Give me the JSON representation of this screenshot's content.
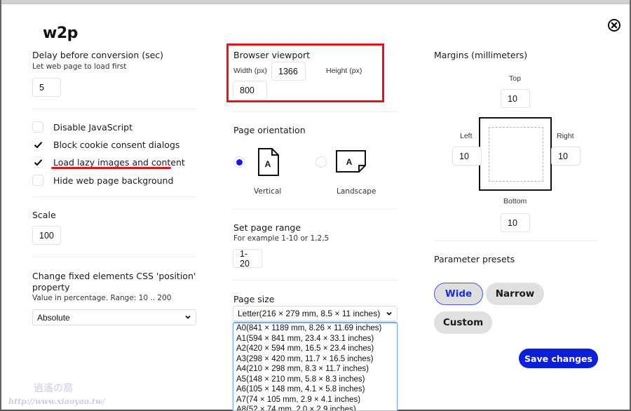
{
  "app": {
    "logo_text": "w2p",
    "close_icon": "close-circle-icon"
  },
  "delay": {
    "title": "Delay before conversion (sec)",
    "hint": "Let web page to load first",
    "value": "5"
  },
  "options": [
    {
      "label": "Disable JavaScript",
      "checked": false
    },
    {
      "label": "Block cookie consent dialogs",
      "checked": true
    },
    {
      "label": "Load lazy images and content",
      "checked": true
    },
    {
      "label": "Hide web page background",
      "checked": false
    }
  ],
  "scale": {
    "title": "Scale",
    "value": "100"
  },
  "css_position": {
    "title_line1": "Change fixed elements CSS 'position'",
    "title_line2": "property",
    "hint": "Value in percentage. Range: 10 .. 200",
    "selected": "Absolute"
  },
  "viewport": {
    "title": "Browser viewport",
    "width_label": "Width (px)",
    "width_value": "1366",
    "height_label": "Height (px)",
    "height_value": "800"
  },
  "orientation": {
    "title": "Page orientation",
    "options": [
      {
        "label": "Vertical",
        "selected": true,
        "icon_letter": "A"
      },
      {
        "label": "Landscape",
        "selected": false,
        "icon_letter": "A"
      }
    ]
  },
  "page_range": {
    "title": "Set page range",
    "hint": "For example 1-10 or 1,2,5",
    "value": "1-20"
  },
  "page_size": {
    "title": "Page size",
    "selected": "Letter(216 × 279 mm, 8.5 × 11 inches)",
    "options": [
      "A0(841 × 1189 mm, 8.26 × 11.69 inches)",
      "A1(594 × 841 mm, 23.4 × 33.1 inches)",
      "A2(420 × 594 mm, 16.5 × 23.4 inches)",
      "A3(298 × 420 mm, 11.7 × 16.5 inches)",
      "A4(210 × 298 mm, 8.3 × 11.7 inches)",
      "A5(148 × 210 mm, 5.8 × 8.3 inches)",
      "A6(105 × 148 mm, 4.1 × 5.8 inches)",
      "A7(74 × 105 mm, 2.9 × 4.1 inches)",
      "A8(52 × 74 mm, 2.0 × 2.9 inches)"
    ]
  },
  "margins": {
    "title": "Margins (millimeters)",
    "top_label": "Top",
    "top_value": "10",
    "left_label": "Left",
    "left_value": "10",
    "right_label": "Right",
    "right_value": "10",
    "bottom_label": "Bottom",
    "bottom_value": "10"
  },
  "presets": {
    "title": "Parameter presets",
    "buttons": [
      {
        "label": "Wide",
        "active": true
      },
      {
        "label": "Narrow",
        "active": false
      },
      {
        "label": "Custom",
        "active": false
      }
    ]
  },
  "save_label": "Save changes",
  "watermark": {
    "url": "http://www.xiaoyao.tw/",
    "logo": "逍遙の窩"
  },
  "colors": {
    "accent": "#0a1fd6",
    "annotation_red": "#e0141e",
    "preset_bg": "#e0e0e0"
  }
}
